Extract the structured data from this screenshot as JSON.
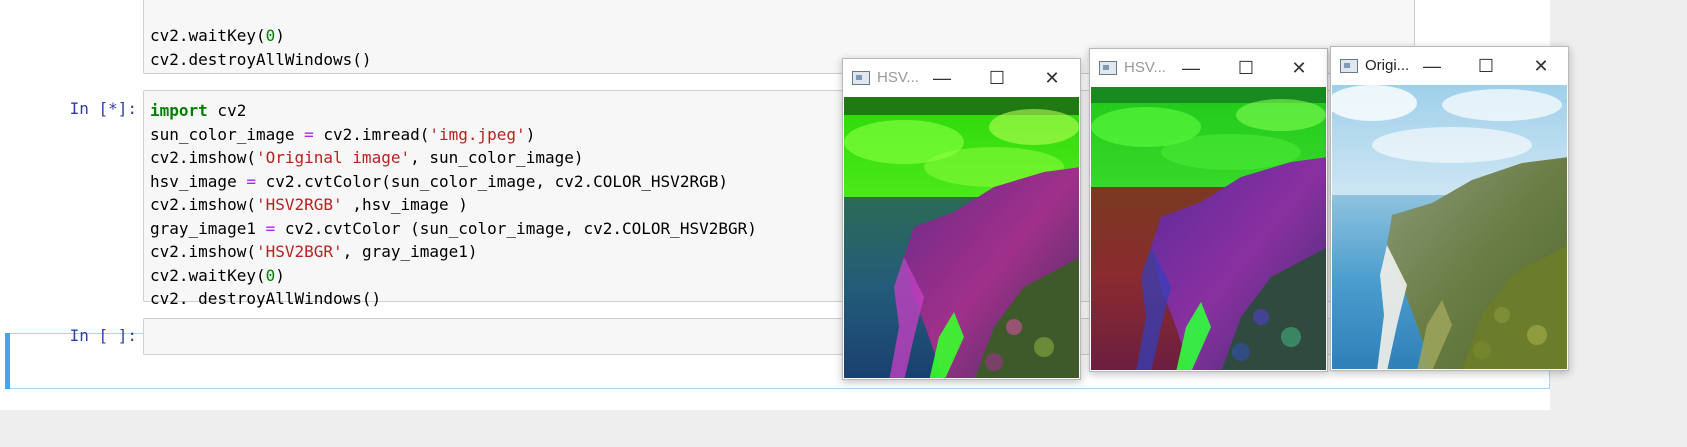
{
  "cells": [
    {
      "prompt": "",
      "lines": [
        [
          {
            "t": "cv2.waitKey("
          },
          {
            "t": "0",
            "c": "num"
          },
          {
            "t": ")"
          }
        ],
        [
          {
            "t": "cv2.destroyAllWindows()"
          }
        ]
      ]
    },
    {
      "prompt": "In [*]:",
      "lines": [
        [
          {
            "t": "import",
            "c": "kw"
          },
          {
            "t": " cv2"
          }
        ],
        [
          {
            "t": "sun_color_image "
          },
          {
            "t": "=",
            "c": "op"
          },
          {
            "t": " cv2.imread("
          },
          {
            "t": "'img.jpeg'",
            "c": "str"
          },
          {
            "t": ")"
          }
        ],
        [
          {
            "t": "cv2.imshow("
          },
          {
            "t": "'Original image'",
            "c": "str"
          },
          {
            "t": ", sun_color_image)"
          }
        ],
        [
          {
            "t": "hsv_image "
          },
          {
            "t": "=",
            "c": "op"
          },
          {
            "t": " cv2.cvtColor(sun_color_image, cv2.COLOR_HSV2RGB)"
          }
        ],
        [
          {
            "t": "cv2.imshow("
          },
          {
            "t": "'HSV2RGB'",
            "c": "str"
          },
          {
            "t": " ,hsv_image )"
          }
        ],
        [
          {
            "t": "gray_image1 "
          },
          {
            "t": "=",
            "c": "op"
          },
          {
            "t": " cv2.cvtColor (sun_color_image, cv2.COLOR_HSV2BGR)"
          }
        ],
        [
          {
            "t": "cv2.imshow("
          },
          {
            "t": "'HSV2BGR'",
            "c": "str"
          },
          {
            "t": ", gray_image1)"
          }
        ],
        [
          {
            "t": "cv2.waitKey("
          },
          {
            "t": "0",
            "c": "num"
          },
          {
            "t": ")"
          }
        ],
        [
          {
            "t": "cv2. destroyAllWindows()"
          }
        ]
      ]
    },
    {
      "prompt": "In [ ]:",
      "lines": []
    }
  ],
  "windows": [
    {
      "title": "HSV...",
      "variant": "hsv2rgb"
    },
    {
      "title": "HSV...",
      "variant": "hsv2bgr"
    },
    {
      "title": "Origi...",
      "variant": "original"
    }
  ],
  "controls": {
    "minimize": "—",
    "maximize": "☐",
    "close": "✕"
  },
  "colors": {
    "prompt": "#303f9f",
    "keyword": "#008000",
    "string": "#ba2121",
    "operator": "#aa22ff",
    "selected": "#42a5f5"
  }
}
